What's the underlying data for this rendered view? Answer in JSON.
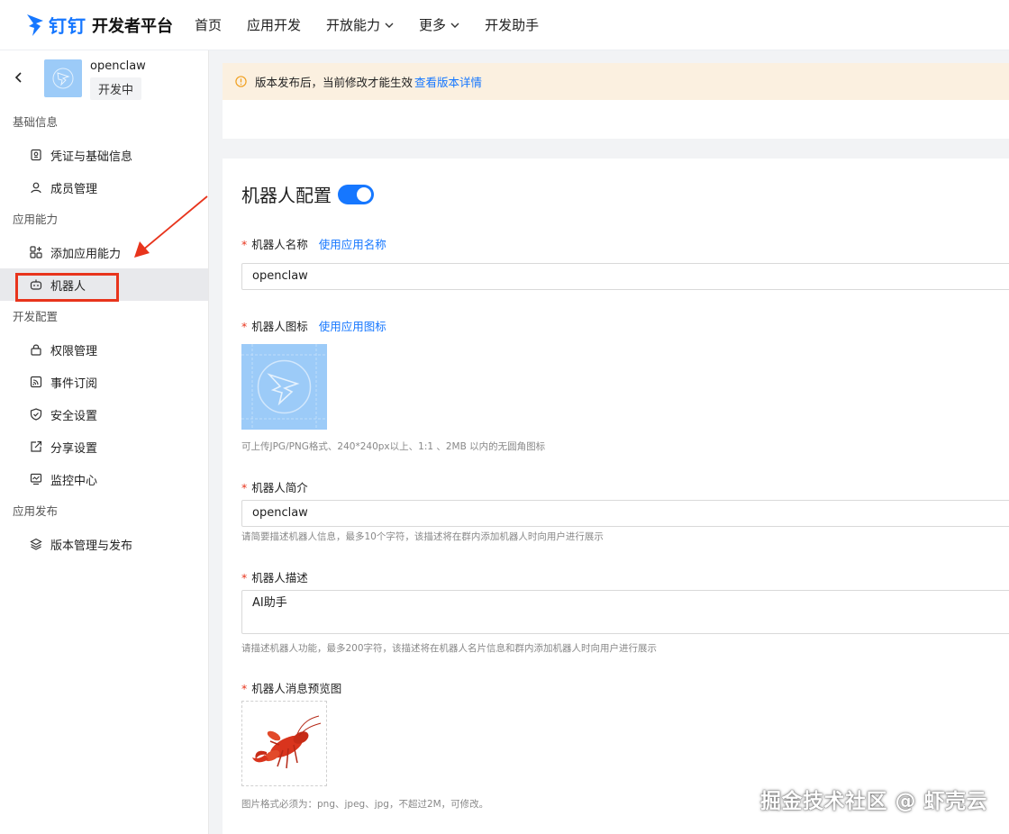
{
  "topnav": {
    "brand": "钉钉",
    "title": "开发者平台",
    "items": [
      {
        "label": "首页",
        "dropdown": false
      },
      {
        "label": "应用开发",
        "dropdown": false
      },
      {
        "label": "开放能力",
        "dropdown": true
      },
      {
        "label": "更多",
        "dropdown": true
      },
      {
        "label": "开发助手",
        "dropdown": false
      }
    ]
  },
  "app": {
    "name": "openclaw",
    "status": "开发中"
  },
  "sidebar": {
    "sections": [
      {
        "title": "基础信息",
        "items": [
          {
            "label": "凭证与基础信息",
            "icon": "credential-icon"
          },
          {
            "label": "成员管理",
            "icon": "user-icon"
          }
        ]
      },
      {
        "title": "应用能力",
        "items": [
          {
            "label": "添加应用能力",
            "icon": "apps-add-icon"
          },
          {
            "label": "机器人",
            "icon": "robot-icon",
            "active": true
          }
        ]
      },
      {
        "title": "开发配置",
        "items": [
          {
            "label": "权限管理",
            "icon": "lock-icon"
          },
          {
            "label": "事件订阅",
            "icon": "rss-icon"
          },
          {
            "label": "安全设置",
            "icon": "shield-icon"
          },
          {
            "label": "分享设置",
            "icon": "share-icon"
          },
          {
            "label": "监控中心",
            "icon": "monitor-icon"
          }
        ]
      },
      {
        "title": "应用发布",
        "items": [
          {
            "label": "版本管理与发布",
            "icon": "layers-icon"
          }
        ]
      }
    ]
  },
  "banner": {
    "text": "版本发布后，当前修改才能生效",
    "link": "查看版本详情"
  },
  "robot_config": {
    "title": "机器人配置",
    "enabled": true,
    "name_label": "机器人名称",
    "name_link": "使用应用名称",
    "name_value": "openclaw",
    "icon_label": "机器人图标",
    "icon_link": "使用应用图标",
    "icon_hint": "可上传JPG/PNG格式、240*240px以上、1:1 、2MB 以内的无圆角图标",
    "intro_label": "机器人简介",
    "intro_value": "openclaw",
    "intro_hint": "请简要描述机器人信息，最多10个字符，该描述将在群内添加机器人时向用户进行展示",
    "desc_label": "机器人描述",
    "desc_value": "AI助手",
    "desc_hint": "请描述机器人功能，最多200字符，该描述将在机器人名片信息和群内添加机器人时向用户进行展示",
    "preview_label": "机器人消息预览图",
    "preview_hint": "图片格式必须为：png、jpeg、jpg，不超过2M，可修改。"
  },
  "watermark": "掘金技术社区 @ 虾壳云",
  "colors": {
    "accent": "#1677ff",
    "highlight": "#e8341c",
    "banner_bg": "#fbf0e0"
  }
}
